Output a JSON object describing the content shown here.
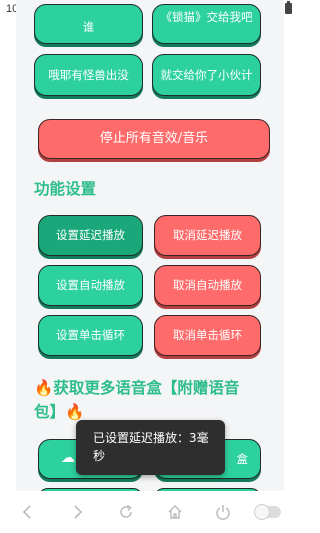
{
  "status_bar": {
    "time": "10:00",
    "notification_icons": "⬇ ⬇ ⬇ •"
  },
  "grid_top": {
    "row1": [
      "谁",
      "《锁猫》交给我吧"
    ],
    "row2": [
      "哦耶有怪兽出没",
      "就交给你了小伙计"
    ]
  },
  "stop_all_label": "停止所有音效/音乐",
  "settings": {
    "title": "功能设置",
    "buttons": [
      {
        "label": "设置延迟播放",
        "style": "green-dark"
      },
      {
        "label": "取消延迟播放",
        "style": "red"
      },
      {
        "label": "设置自动播放",
        "style": "green"
      },
      {
        "label": "取消自动播放",
        "style": "red"
      },
      {
        "label": "设置单击循环",
        "style": "green"
      },
      {
        "label": "取消单击循环",
        "style": "red"
      }
    ]
  },
  "more": {
    "fire_icon": "🔥",
    "title_line1": "获取更多语音盒【附赠语音",
    "title_line2": "包】",
    "partial_right_label": "盒"
  },
  "toast": {
    "text": "已设置延迟播放：3毫秒"
  },
  "colors": {
    "green": "#2dd19e",
    "red": "#ff6b6b",
    "section_title": "#2dbd8a",
    "toast": "#2e2e2e"
  }
}
